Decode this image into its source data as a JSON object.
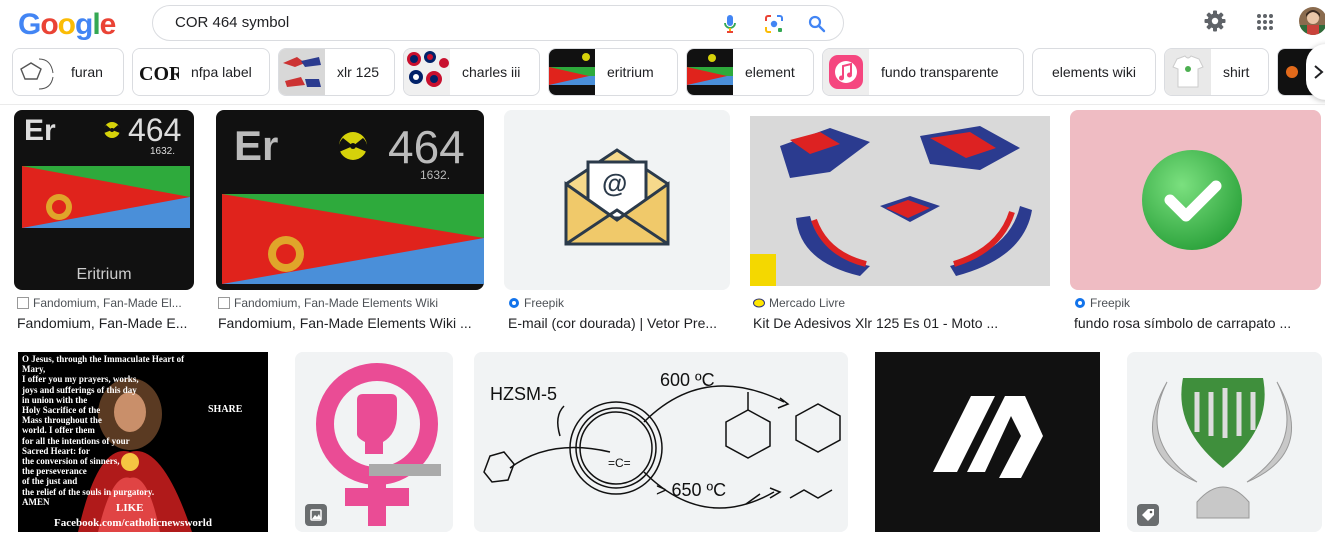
{
  "logo": {
    "letters": [
      "G",
      "o",
      "o",
      "g",
      "l",
      "e"
    ]
  },
  "search": {
    "query": "COR 464 symbol"
  },
  "chips": [
    {
      "label": "furan"
    },
    {
      "label": "nfpa label"
    },
    {
      "label": "xlr 125"
    },
    {
      "label": "charles iii"
    },
    {
      "label": "eritrium"
    },
    {
      "label": "element"
    },
    {
      "label": "fundo transparente"
    },
    {
      "label": "elements wiki"
    },
    {
      "label": "shirt"
    }
  ],
  "colors": {
    "blue": "#4285f4",
    "red": "#ea4335",
    "yellow": "#fbbc05",
    "green": "#34a853"
  },
  "results_row1": [
    {
      "source": "Fandomium, Fan-Made El...",
      "title": "Fandomium, Fan-Made E..."
    },
    {
      "source": "Fandomium, Fan-Made Elements Wiki",
      "title": "Fandomium, Fan-Made Elements Wiki ..."
    },
    {
      "source": "Freepik",
      "title": "E-mail (cor dourada) | Vetor Pre..."
    },
    {
      "source": "Mercado Livre",
      "title": "Kit De Adesivos Xlr 125 Es 01 - Moto ..."
    },
    {
      "source": "Freepik",
      "title": "fundo rosa símbolo de carrapato ..."
    }
  ],
  "element_card": {
    "symbol": "Er",
    "number": "464",
    "mass": "1632.",
    "name": "Eritrium"
  },
  "email_icon": {
    "glyph": "@"
  },
  "prayer": {
    "lines": [
      "O Jesus, through the Immaculate Heart of Mary,",
      "I offer you my prayers, works,",
      "joys and sufferings of this day",
      "in union with the",
      "Holy Sacrifice of the",
      "Mass throughout the",
      "world. I offer them",
      "for all the intentions of your",
      "Sacred Heart: for",
      "the conversion of sinners,",
      "the perseverance",
      "of the just and",
      "the relief of the souls in purgatory.",
      "AMEN"
    ],
    "share": "SHARE",
    "like": "LIKE",
    "footer": "Facebook.com/catholicnewsworld"
  },
  "chem": {
    "catalyst": "HZSM-5",
    "t1": "600 ºC",
    "t2": "> 650 ºC",
    "center": "=C="
  }
}
